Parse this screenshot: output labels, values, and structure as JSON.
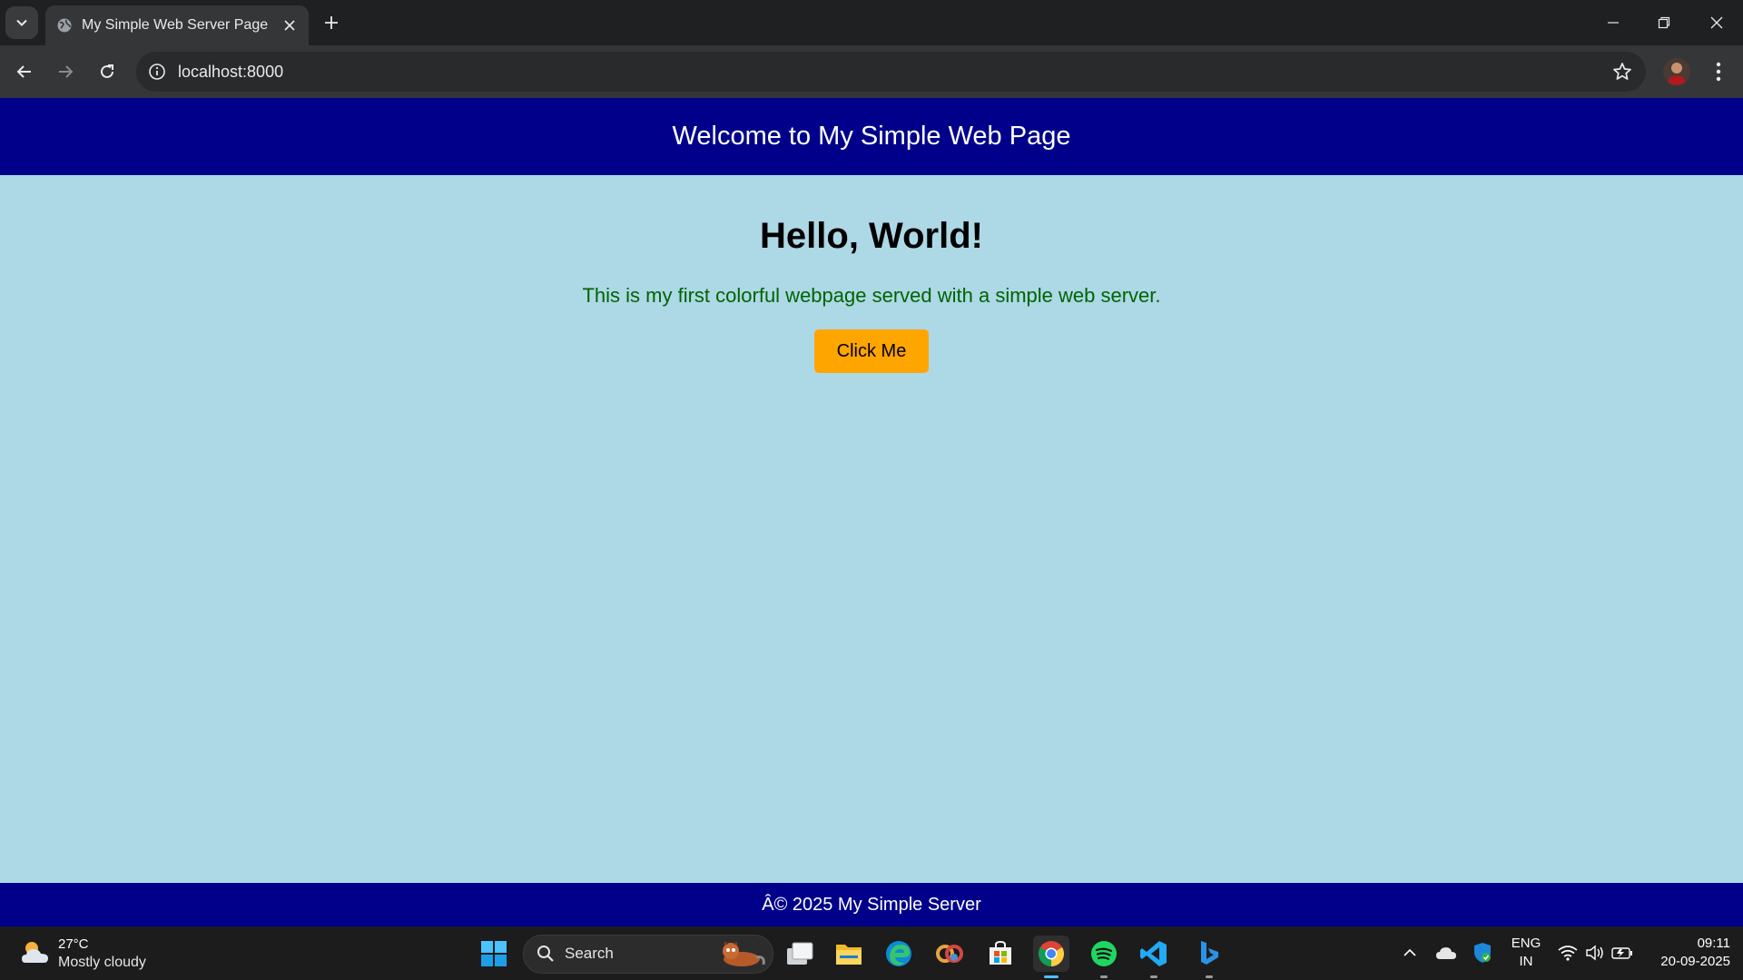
{
  "browser": {
    "tab_title": "My Simple Web Server Page",
    "url": "localhost:8000"
  },
  "page": {
    "header_title": "Welcome to My Simple Web Page",
    "heading": "Hello, World!",
    "intro": "This is my first colorful webpage served with a simple web server.",
    "button_label": "Click Me",
    "footer": "Â© 2025 My Simple Server",
    "colors": {
      "header_bg": "#00008b",
      "body_bg": "#add8e6",
      "intro_text": "#006400",
      "button_bg": "#ffa500"
    }
  },
  "taskbar": {
    "weather_temp": "27°C",
    "weather_condition": "Mostly cloudy",
    "search_label": "Search",
    "pinned_apps": [
      "task-view",
      "file-explorer",
      "edge",
      "copilot",
      "microsoft-store",
      "chrome",
      "spotify",
      "vscode",
      "bing"
    ],
    "language": "ENG",
    "region": "IN",
    "time": "09:11",
    "date": "20-09-2025"
  }
}
